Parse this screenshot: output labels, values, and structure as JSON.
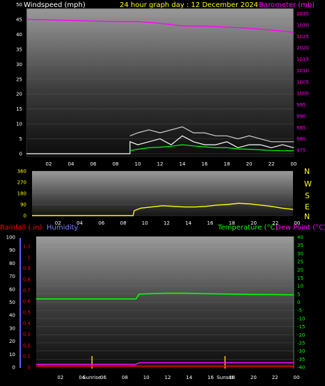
{
  "header": {
    "windspeed_label": "Windspeed (mph)",
    "title": "24 hour graph day : 12 December 2024",
    "barometer_label": "Barometer (mb)"
  },
  "direction_letters": [
    "N",
    "W",
    "S",
    "E",
    "N"
  ],
  "lower_header": {
    "rainfall_label": "Rainfall (.in)",
    "humidity_label": "Humidity",
    "temperature_label": "Temperature (°C)",
    "dewpoint_label": "Dew Point (°C)"
  },
  "colors": {
    "windspeed": "#ffffff",
    "gust": "#d0d0d0",
    "wind_avg": "#00ff00",
    "barometer": "#ff00ff",
    "direction": "#ffff00",
    "rainfall": "#ff0000",
    "humidity": "#8080ff",
    "temperature": "#00ff00",
    "dewpoint": "#ff00ff",
    "title": "#ffff00"
  },
  "sun_events": [
    "Sunrise",
    "Sunset"
  ],
  "chart_data": [
    {
      "type": "line",
      "name": "wind-barometer",
      "x_ticks": [
        "02",
        "04",
        "06",
        "08",
        "10",
        "12",
        "14",
        "16",
        "18",
        "20",
        "22",
        "00"
      ],
      "y_left_ticks": [
        0,
        5,
        10,
        15,
        20,
        25,
        30,
        35,
        40,
        45,
        50
      ],
      "y_left_range": [
        0,
        50
      ],
      "y_right_ticks": [
        975,
        980,
        985,
        990,
        995,
        1000,
        1005,
        1010,
        1015,
        1020,
        1025,
        1030,
        1035
      ],
      "y_right_range": [
        973.5,
        1039
      ],
      "x_range_hours": [
        0,
        24
      ],
      "series": [
        {
          "key": "barometer",
          "axis": "right",
          "x": [
            0,
            4,
            8,
            10,
            12,
            14,
            16,
            18,
            20,
            22,
            24
          ],
          "y": [
            1032.5,
            1032.0,
            1031.5,
            1031.5,
            1030.8,
            1029.6,
            1029.5,
            1029.1,
            1028.6,
            1027.8,
            1026.8
          ]
        },
        {
          "key": "windspeed",
          "axis": "left",
          "x": [
            0,
            9.3,
            9.3,
            10,
            11,
            12,
            13,
            14,
            15,
            16,
            17,
            18,
            19,
            20,
            21,
            22,
            23,
            24
          ],
          "y": [
            0,
            0,
            4,
            3,
            4,
            5,
            3,
            6,
            4,
            3,
            3,
            4,
            2,
            3,
            3,
            2,
            3,
            2
          ]
        },
        {
          "key": "gust",
          "axis": "left",
          "x": [
            9.3,
            10,
            11,
            12,
            13,
            14,
            15,
            16,
            17,
            18,
            19,
            20,
            21,
            22,
            23,
            24
          ],
          "y": [
            6,
            7,
            8,
            7,
            8,
            9,
            7,
            7,
            6,
            6,
            5,
            6,
            5,
            4,
            4,
            4
          ]
        },
        {
          "key": "wind_avg",
          "axis": "left",
          "x": [
            9.3,
            10,
            11,
            12,
            13,
            14,
            15,
            16,
            17,
            18,
            19,
            20,
            21,
            22,
            23,
            24
          ],
          "y": [
            1,
            1.5,
            2,
            2.2,
            2.5,
            3,
            2.6,
            2.3,
            2,
            2,
            1.6,
            1.5,
            1.3,
            1.1,
            1,
            1
          ]
        }
      ]
    },
    {
      "type": "line",
      "name": "wind-direction",
      "x_ticks": [
        "02",
        "04",
        "06",
        "08",
        "10",
        "12",
        "14",
        "16",
        "18",
        "20",
        "22",
        "00"
      ],
      "y_ticks": [
        0,
        90,
        180,
        270,
        360
      ],
      "y_range": [
        0,
        360
      ],
      "x_range_hours": [
        0,
        24
      ],
      "series": [
        {
          "key": "direction",
          "x": [
            0,
            9.3,
            9.4,
            10,
            11,
            12,
            13,
            14,
            15,
            16,
            17,
            18,
            19,
            20,
            21,
            22,
            23,
            24
          ],
          "y": [
            0,
            0,
            40,
            60,
            70,
            80,
            75,
            70,
            70,
            75,
            85,
            90,
            100,
            95,
            85,
            75,
            60,
            50
          ]
        }
      ]
    },
    {
      "type": "line",
      "name": "temperature-humidity-rain",
      "x_ticks": [
        "02",
        "04",
        "Sunrise",
        "06",
        "08",
        "10",
        "12",
        "14",
        "16",
        "18",
        "Sunset",
        "20",
        "22",
        "00"
      ],
      "y_humidity_ticks": [
        0,
        10,
        20,
        30,
        40,
        50,
        60,
        70,
        80,
        90,
        100
      ],
      "y_rain_ticks": [
        0,
        0.1,
        0.2,
        0.3,
        0.4,
        0.5,
        0.6,
        0.7,
        0.8,
        0.9,
        1,
        1.1
      ],
      "y_temp_ticks": [
        -40,
        -35,
        -30,
        -25,
        -20,
        -15,
        -10,
        -5,
        0,
        5,
        10,
        15,
        20,
        25,
        30,
        35,
        40
      ],
      "y_temp_range": [
        -40,
        40
      ],
      "x_range_hours": [
        0,
        24
      ],
      "series": [
        {
          "key": "temperature",
          "x": [
            0,
            9.3,
            9.6,
            12,
            14,
            16,
            18,
            20,
            22,
            24
          ],
          "y": [
            2,
            2,
            5,
            5.5,
            5.5,
            5.2,
            5,
            4.8,
            4.7,
            4.5
          ]
        },
        {
          "key": "dewpoint",
          "x": [
            0,
            9.3,
            9.6,
            24
          ],
          "y": [
            -38.2,
            -38.2,
            -37.2,
            -37.2
          ]
        },
        {
          "key": "rainfall",
          "x": [
            0,
            24
          ],
          "y": [
            -39.3,
            -39.3
          ]
        }
      ],
      "sun_event_hours": [
        5.2,
        17.6
      ]
    }
  ]
}
